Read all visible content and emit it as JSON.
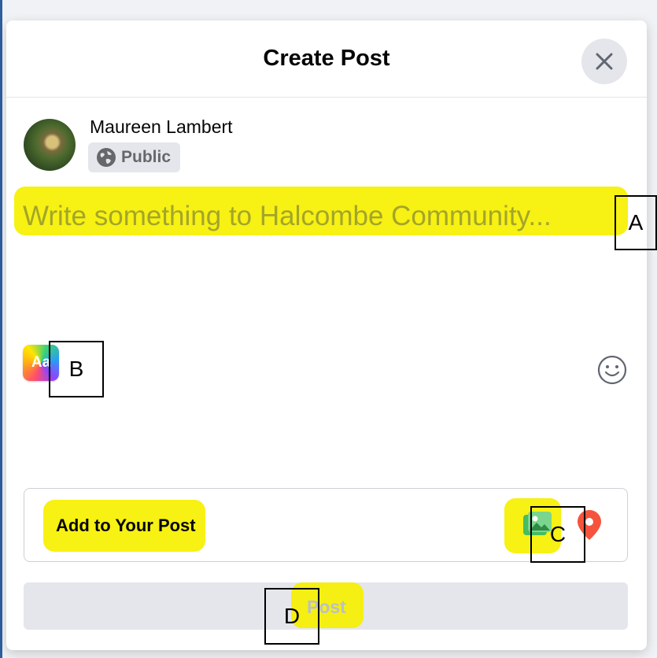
{
  "dialog": {
    "title": "Create Post",
    "close_icon": "close-icon"
  },
  "user": {
    "name": "Maureen Lambert",
    "audience": "Public",
    "audience_icon": "globe-icon"
  },
  "composer": {
    "placeholder": "Write something to Halcombe Community..."
  },
  "toolbar": {
    "text_style_label": "Aa",
    "emoji_icon": "smiley-icon"
  },
  "add_to_post": {
    "label": "Add to Your Post",
    "icons": [
      "photo-video-icon",
      "location-pin-icon"
    ]
  },
  "post_button": {
    "label": "Post"
  },
  "annotations": {
    "a": "A",
    "b": "B",
    "c": "C",
    "d": "D"
  },
  "colors": {
    "highlight": "#f6f000",
    "photo_icon": "#45bd62",
    "location_icon": "#f5533d"
  }
}
